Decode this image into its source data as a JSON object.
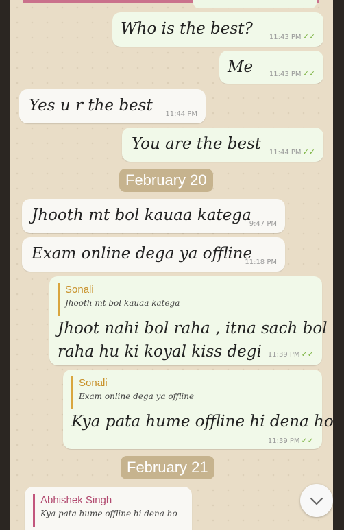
{
  "messages": [
    {
      "text": "Who is the best?",
      "time": "11:43 PM",
      "dir": "out"
    },
    {
      "text": "Me",
      "time": "11:43 PM",
      "dir": "out"
    },
    {
      "text": "Yes u r the best",
      "time": "11:44 PM",
      "dir": "in"
    },
    {
      "text": "You are the best",
      "time": "11:44 PM",
      "dir": "out"
    }
  ],
  "date_feb20": "February 20",
  "msg_jhooth": {
    "text": "Jhooth mt bol kauaa katega",
    "time": "9:47 PM"
  },
  "msg_exam": {
    "text": "Exam online dega ya offline",
    "time": "11:18 PM"
  },
  "reply1": {
    "quote_name": "Sonali",
    "quote_text": "Jhooth mt bol kauaa katega",
    "line1": "Jhoot nahi bol raha , itna sach bol",
    "line2": "raha hu ki koyal kiss degi",
    "time": "11:39 PM"
  },
  "reply2": {
    "quote_name": "Sonali",
    "quote_text": "Exam online dega ya offline",
    "text": "Kya pata hume offline hi dena ho",
    "time": "11:39 PM"
  },
  "date_feb21": "February 21",
  "reply3": {
    "quote_name": "Abhishek Singh",
    "quote_text": "Kya pata hume offline hi dena ho"
  },
  "icons": {
    "tick": "double-check-icon",
    "scroll": "chevron-down-icon"
  },
  "colors": {
    "tick": "#7cb342",
    "outgoing": "#f1f9e9",
    "date_chip": "#c6b38e"
  }
}
